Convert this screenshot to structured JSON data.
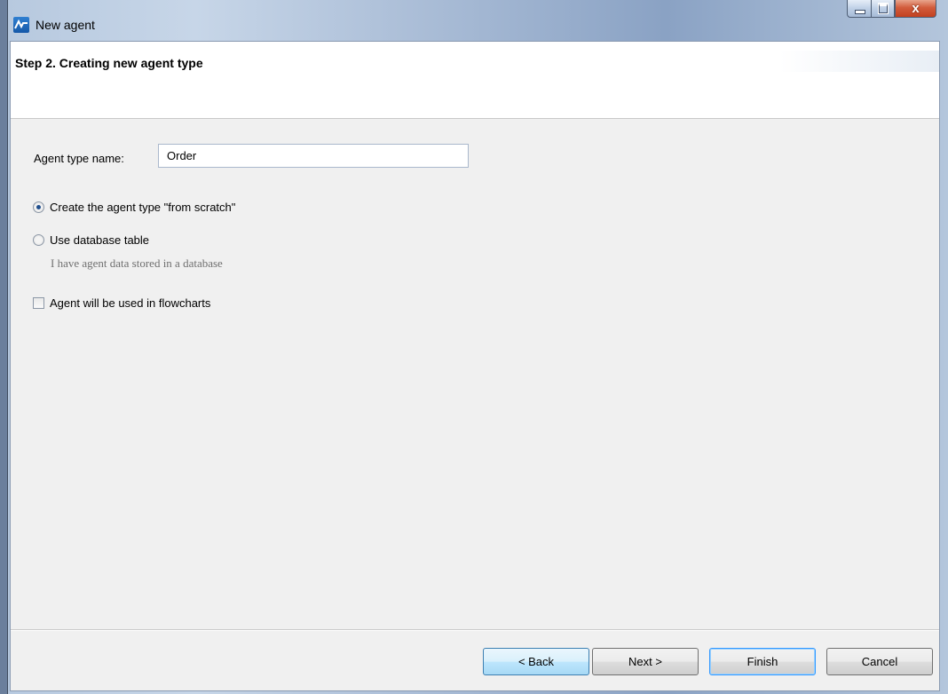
{
  "window": {
    "title": "New agent",
    "controls": {
      "minimize": "",
      "maximize": "",
      "close": "x"
    }
  },
  "header": {
    "step_title": "Step 2. Creating new agent type"
  },
  "form": {
    "name_label": "Agent type name:",
    "name_value": "Order",
    "options": [
      {
        "label": "Create the agent type \"from scratch\"",
        "selected": true
      },
      {
        "label": "Use database table",
        "selected": false,
        "hint": "I have agent data stored in a database"
      }
    ],
    "flowcharts_checkbox": {
      "label": "Agent will be used in flowcharts",
      "checked": false
    }
  },
  "buttons": {
    "back": "< Back",
    "next": "Next >",
    "finish": "Finish",
    "cancel": "Cancel"
  }
}
